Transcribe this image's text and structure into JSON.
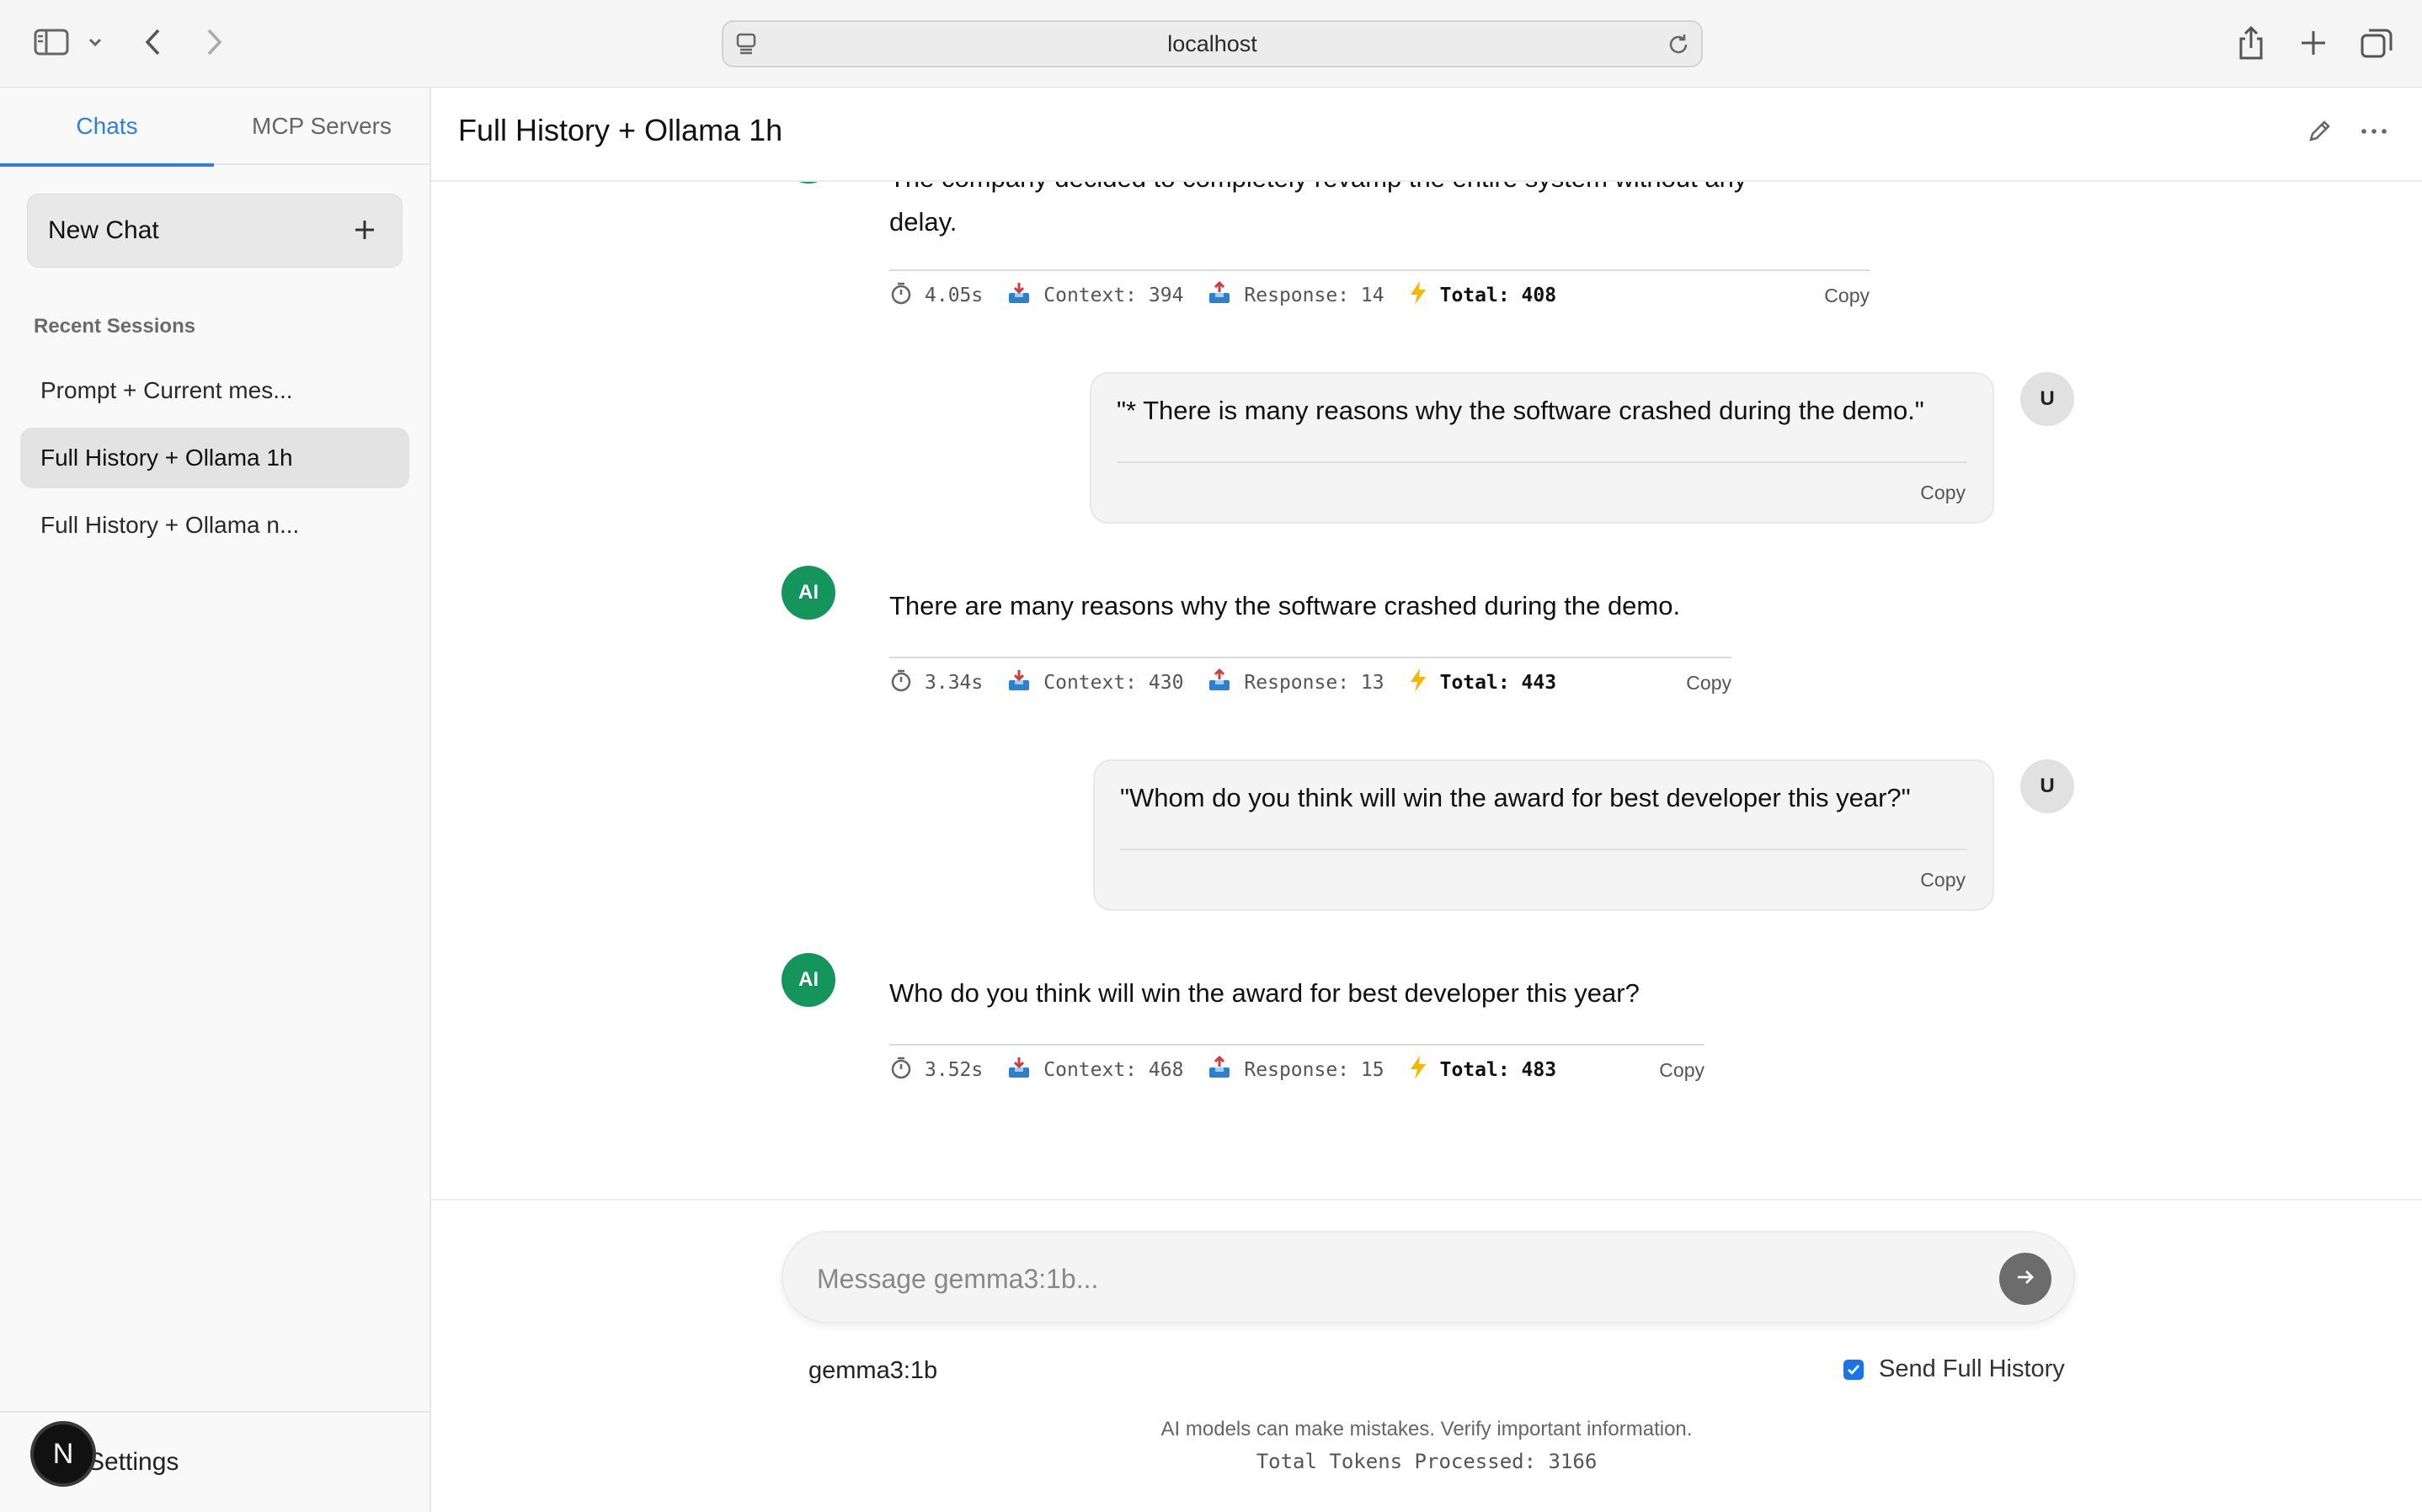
{
  "browser": {
    "url": "localhost",
    "icons": [
      "sidebar-toggle-icon",
      "chevron-down-icon",
      "back-icon",
      "forward-icon",
      "page-icon",
      "reload-icon",
      "share-icon",
      "new-tab-icon",
      "tabs-overview-icon"
    ]
  },
  "sidebar": {
    "tabs": [
      {
        "label": "Chats",
        "active": true
      },
      {
        "label": "MCP Servers",
        "active": false
      }
    ],
    "new_chat_label": "New Chat",
    "recent_title": "Recent Sessions",
    "sessions": [
      {
        "label": "Prompt + Current mes...",
        "active": false
      },
      {
        "label": "Full History + Ollama 1h",
        "active": true
      },
      {
        "label": "Full History + Ollama n...",
        "active": false
      }
    ],
    "avatar_letter": "N",
    "settings_label": "Settings"
  },
  "header": {
    "title": "Full History + Ollama 1h",
    "icons": [
      "edit-icon",
      "more-icon"
    ]
  },
  "messages": [
    {
      "role": "ai",
      "partial": true,
      "text_top_clipped": "The company decided to completely revamp the entire system without any",
      "text": "delay.",
      "time": "4.05s",
      "context": "Context: 394",
      "response": "Response: 14",
      "total": "Total: 408",
      "copy_label": "Copy"
    },
    {
      "role": "user",
      "avatar": "U",
      "text": "\"* There is many reasons why the software crashed during the demo.\"",
      "copy_label": "Copy"
    },
    {
      "role": "ai",
      "avatar": "AI",
      "text": "There are many reasons why the software crashed during the demo.",
      "time": "3.34s",
      "context": "Context: 430",
      "response": "Response: 13",
      "total": "Total: 443",
      "copy_label": "Copy"
    },
    {
      "role": "user",
      "avatar": "U",
      "text": "\"Whom do you think will win the award for best developer this year?\"",
      "copy_label": "Copy"
    },
    {
      "role": "ai",
      "avatar": "AI",
      "text": "Who do you think will win the award for best developer this year?",
      "time": "3.52s",
      "context": "Context: 468",
      "response": "Response: 15",
      "total": "Total: 483",
      "copy_label": "Copy"
    }
  ],
  "composer": {
    "placeholder": "Message gemma3:1b...",
    "value": "",
    "model": "gemma3:1b",
    "full_history_label": "Send Full History",
    "full_history_checked": true,
    "disclaimer": "AI models can make mistakes. Verify important information.",
    "tokens_processed": "Total Tokens Processed: 3166"
  },
  "colors": {
    "accent": "#2f7fe0",
    "ai_avatar": "#13955b",
    "send_button": "#6c6c6c"
  }
}
